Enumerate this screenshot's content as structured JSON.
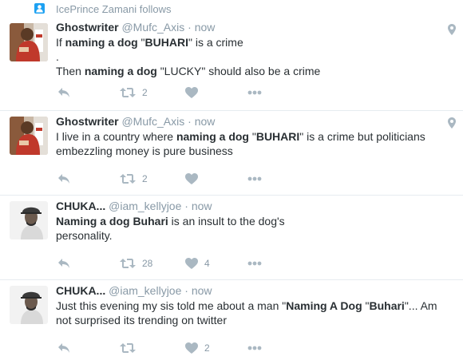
{
  "notification": {
    "follow_text": "IcePrince Zamani follows",
    "icon": "person-icon"
  },
  "colors": {
    "accent": "#1da1f2",
    "muted": "#8899a6",
    "text": "#292f33",
    "divider": "#e6ecf0"
  },
  "tweets": [
    {
      "name": "Ghostwriter",
      "handle": "@Mufc_Axis",
      "separator": "·",
      "time": "now",
      "avatar_icon": "avatar-ghostwriter",
      "has_location": true,
      "line1": {
        "a": "If ",
        "b": "naming a dog",
        "c": " \"",
        "d": "BUHARI",
        "e": "\" is a crime"
      },
      "line2": ".",
      "line3": {
        "a": "Then ",
        "b": "naming a dog",
        "c": " \"LUCKY\" should also be a crime"
      },
      "retweets": "2",
      "likes": ""
    },
    {
      "name": "Ghostwriter",
      "handle": "@Mufc_Axis",
      "separator": "·",
      "time": "now",
      "avatar_icon": "avatar-ghostwriter",
      "has_location": true,
      "text": {
        "a": "I live in a country where ",
        "b": "naming a dog",
        "c": " \"",
        "d": "BUHARI",
        "e": "\" is a crime but politicians embezzling money is pure business"
      },
      "retweets": "2",
      "likes": ""
    },
    {
      "name": "CHUKA...",
      "handle": "@iam_kellyjoe",
      "separator": "·",
      "time": "now",
      "avatar_icon": "avatar-chuka",
      "has_location": false,
      "text": {
        "a": "Naming a dog Buhari",
        "b": " is an insult to the dog's",
        "c": "personality."
      },
      "retweets": "28",
      "likes": "4"
    },
    {
      "name": "CHUKA...",
      "handle": "@iam_kellyjoe",
      "separator": "·",
      "time": "now",
      "avatar_icon": "avatar-chuka",
      "has_location": false,
      "text": {
        "a": "Just this evening my sis told me about a man \"",
        "b": "Naming A Dog",
        "c": " \"",
        "d": "Buhari",
        "e": "\"... Am not surprised its trending on twitter"
      },
      "retweets": "",
      "likes": "2"
    }
  ]
}
